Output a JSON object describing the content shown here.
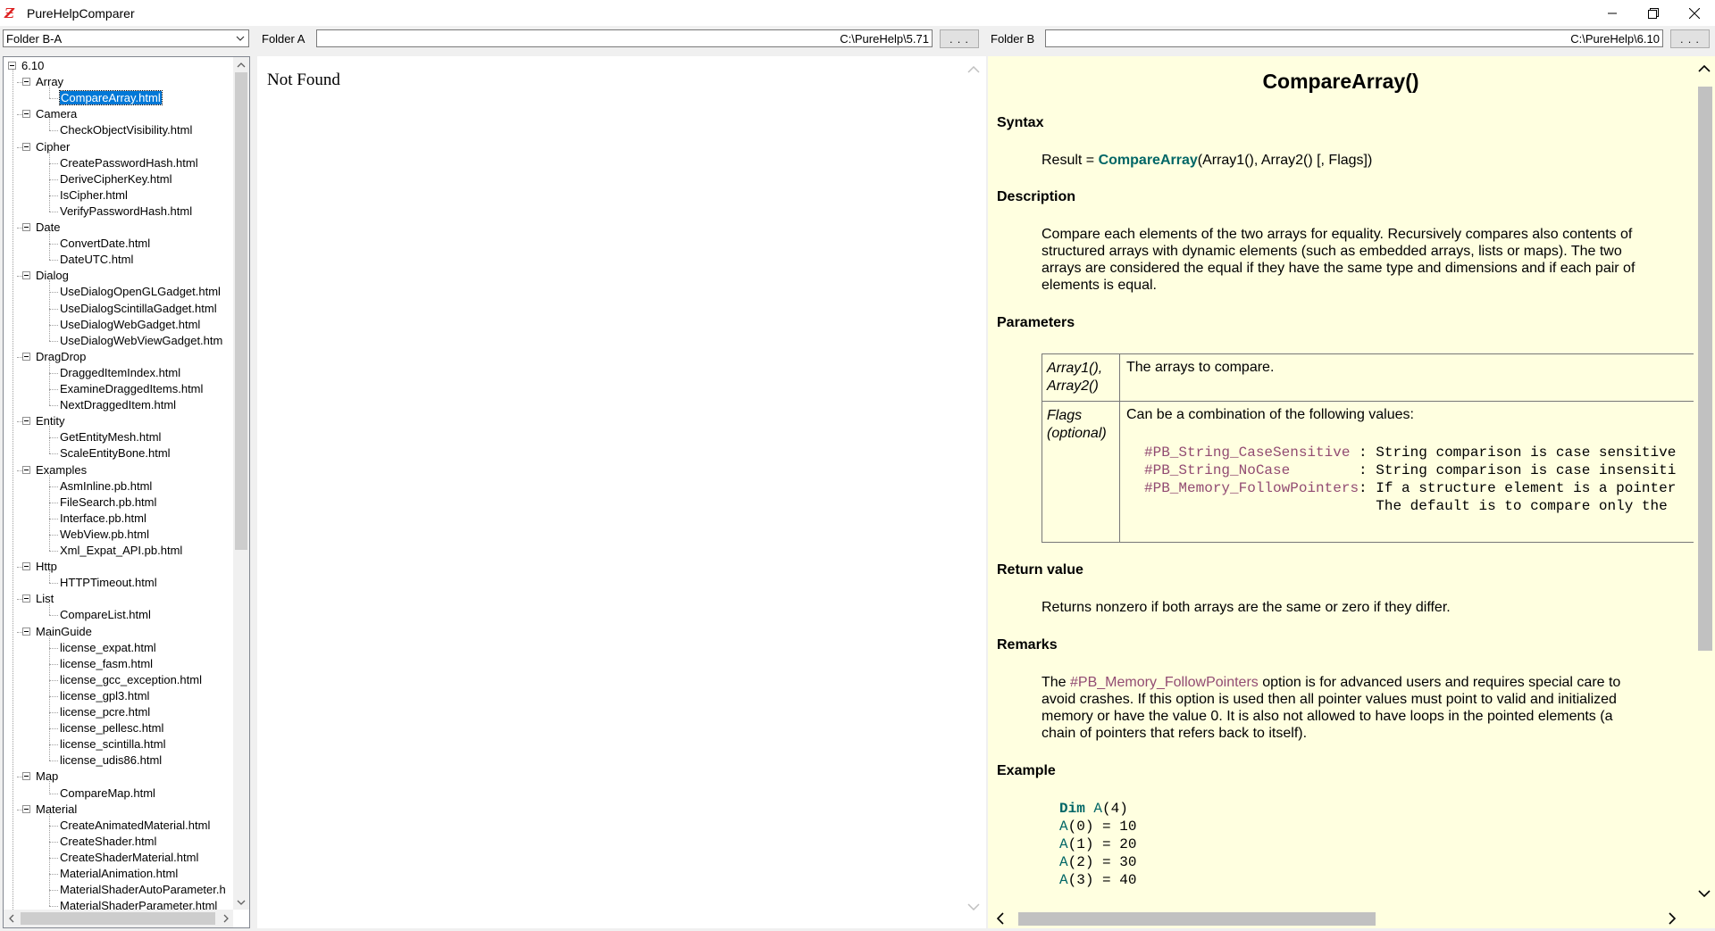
{
  "window": {
    "title": "PureHelpComparer"
  },
  "toolbar": {
    "mode_select": "Folder B-A",
    "folder_a_label": "Folder A",
    "folder_a_path": "C:\\PureHelp\\5.71",
    "folder_b_label": "Folder B",
    "folder_b_path": "C:\\PureHelp\\6.10",
    "browse_label": ". . ."
  },
  "tree": {
    "root": "6.10",
    "rows": [
      {
        "level": 1,
        "label": "Array"
      },
      {
        "level": 2,
        "label": "CompareArray.html",
        "selected": true
      },
      {
        "level": 1,
        "label": "Camera"
      },
      {
        "level": 2,
        "label": "CheckObjectVisibility.html"
      },
      {
        "level": 1,
        "label": "Cipher"
      },
      {
        "level": 2,
        "label": "CreatePasswordHash.html"
      },
      {
        "level": 2,
        "label": "DeriveCipherKey.html"
      },
      {
        "level": 2,
        "label": "IsCipher.html"
      },
      {
        "level": 2,
        "label": "VerifyPasswordHash.html"
      },
      {
        "level": 1,
        "label": "Date"
      },
      {
        "level": 2,
        "label": "ConvertDate.html"
      },
      {
        "level": 2,
        "label": "DateUTC.html"
      },
      {
        "level": 1,
        "label": "Dialog"
      },
      {
        "level": 2,
        "label": "UseDialogOpenGLGadget.html"
      },
      {
        "level": 2,
        "label": "UseDialogScintillaGadget.html"
      },
      {
        "level": 2,
        "label": "UseDialogWebGadget.html"
      },
      {
        "level": 2,
        "label": "UseDialogWebViewGadget.htm"
      },
      {
        "level": 1,
        "label": "DragDrop"
      },
      {
        "level": 2,
        "label": "DraggedItemIndex.html"
      },
      {
        "level": 2,
        "label": "ExamineDraggedItems.html"
      },
      {
        "level": 2,
        "label": "NextDraggedItem.html"
      },
      {
        "level": 1,
        "label": "Entity"
      },
      {
        "level": 2,
        "label": "GetEntityMesh.html"
      },
      {
        "level": 2,
        "label": "ScaleEntityBone.html"
      },
      {
        "level": 1,
        "label": "Examples"
      },
      {
        "level": 2,
        "label": "AsmInline.pb.html"
      },
      {
        "level": 2,
        "label": "FileSearch.pb.html"
      },
      {
        "level": 2,
        "label": "Interface.pb.html"
      },
      {
        "level": 2,
        "label": "WebView.pb.html"
      },
      {
        "level": 2,
        "label": "Xml_Expat_API.pb.html"
      },
      {
        "level": 1,
        "label": "Http"
      },
      {
        "level": 2,
        "label": "HTTPTimeout.html"
      },
      {
        "level": 1,
        "label": "List"
      },
      {
        "level": 2,
        "label": "CompareList.html"
      },
      {
        "level": 1,
        "label": "MainGuide"
      },
      {
        "level": 2,
        "label": "license_expat.html"
      },
      {
        "level": 2,
        "label": "license_fasm.html"
      },
      {
        "level": 2,
        "label": "license_gcc_exception.html"
      },
      {
        "level": 2,
        "label": "license_gpl3.html"
      },
      {
        "level": 2,
        "label": "license_pcre.html"
      },
      {
        "level": 2,
        "label": "license_pellesc.html"
      },
      {
        "level": 2,
        "label": "license_scintilla.html"
      },
      {
        "level": 2,
        "label": "license_udis86.html"
      },
      {
        "level": 1,
        "label": "Map"
      },
      {
        "level": 2,
        "label": "CompareMap.html"
      },
      {
        "level": 1,
        "label": "Material"
      },
      {
        "level": 2,
        "label": "CreateAnimatedMaterial.html"
      },
      {
        "level": 2,
        "label": "CreateShader.html"
      },
      {
        "level": 2,
        "label": "CreateShaderMaterial.html"
      },
      {
        "level": 2,
        "label": "MaterialAnimation.html"
      },
      {
        "level": 2,
        "label": "MaterialShaderAutoParameter.h"
      },
      {
        "level": 2,
        "label": "MaterialShaderParameter.html"
      }
    ]
  },
  "panel_a": {
    "message": "Not Found"
  },
  "panel_b": {
    "title": "CompareArray()",
    "syntax_heading": "Syntax",
    "syntax_prefix": "Result = ",
    "syntax_func": "CompareArray",
    "syntax_args": "(Array1(), Array2() [, Flags])",
    "description_heading": "Description",
    "description": "Compare each elements of the two arrays for equality. Recursively compares also contents of structured arrays with dynamic elements (such as embedded arrays, lists or maps). The two arrays are considered the equal if they have the same type and dimensions and if each pair of elements is equal.",
    "parameters_heading": "Parameters",
    "param1_name_a": "Array1(),",
    "param1_name_b": "Array2()",
    "param1_desc": "The arrays to compare.",
    "param2_name_a": "Flags",
    "param2_name_b": "(optional)",
    "param2_desc": "Can be a combination of the following values:",
    "flags": [
      {
        "name": "#PB_String_CaseSensitive ",
        "desc": ": String comparison is case sensitive"
      },
      {
        "name": "#PB_String_NoCase        ",
        "desc": ": String comparison is case insensiti"
      },
      {
        "name": "#PB_Memory_FollowPointers",
        "desc": ": If a structure element is a pointer"
      },
      {
        "name": "                         ",
        "desc": "  The default is to compare only the"
      }
    ],
    "return_heading": "Return value",
    "return_text": "Returns nonzero if both arrays are the same or zero if they differ.",
    "remarks_heading": "Remarks",
    "remarks_pre": "The ",
    "remarks_const": "#PB_Memory_FollowPointers",
    "remarks_post": " option is for advanced users and requires special care to avoid crashes. If this option is used then all pointer values must point to valid and initialized memory or have the value 0. It is also not allowed to have loops in the pointed elements (a chain of pointers that refers back to itself).",
    "example_heading": "Example",
    "code": [
      {
        "kw": "Dim",
        "rest": " A(4)"
      },
      {
        "kw": "",
        "rest": "A(0) = 10"
      },
      {
        "kw": "",
        "rest": "A(1) = 20"
      },
      {
        "kw": "",
        "rest": "A(2) = 30"
      },
      {
        "kw": "",
        "rest": "A(3) = 40"
      }
    ]
  }
}
